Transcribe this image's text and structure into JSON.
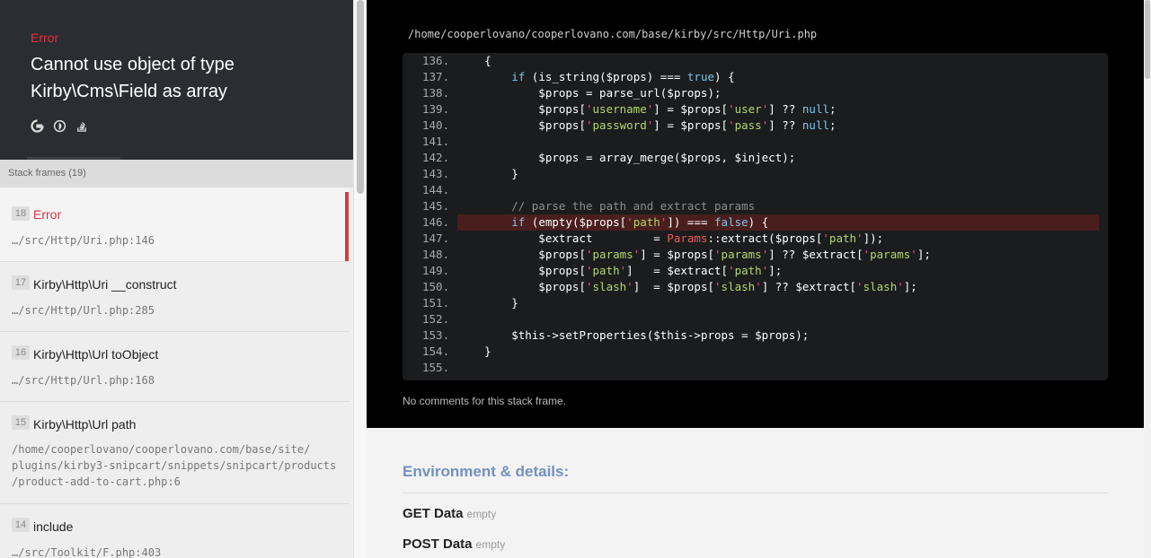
{
  "error": {
    "type": "Error",
    "message": "Cannot use object of type Kirby\\Cms\\Field as array",
    "icons": [
      "google-search-icon",
      "duckduckgo-search-icon",
      "stackoverflow-search-icon"
    ]
  },
  "frames_label": "Stack frames (19)",
  "frames": [
    {
      "num": "18",
      "name": "Error",
      "file": "…/src/Http/Uri.php:146"
    },
    {
      "num": "17",
      "name": "Kirby\\Http\\Uri __construct",
      "file": "…/src/Http/Url.php:285"
    },
    {
      "num": "16",
      "name": "Kirby\\Http\\Url toObject",
      "file": "…/src/Http/Url.php:168"
    },
    {
      "num": "15",
      "name": "Kirby\\Http\\Url path",
      "file": "/home/cooperlovano/cooperlovano.com/base/site/\nplugins/kirby3-snipcart/snippets/snipcart/products\n/product-add-to-cart.php:6"
    },
    {
      "num": "14",
      "name": "include",
      "file": "…/src/Toolkit/F.php:403"
    }
  ],
  "code": {
    "file_path": "/home/cooperlovano/cooperlovano.com/base/kirby/src/Http/Uri.php",
    "highlight_line": "146.",
    "lines": [
      {
        "n": "136.",
        "t": "    {"
      },
      {
        "n": "137.",
        "t": "        if (is_string($props) === true) {"
      },
      {
        "n": "138.",
        "t": "            $props = parse_url($props);"
      },
      {
        "n": "139.",
        "t": "            $props['username'] = $props['user'] ?? null;"
      },
      {
        "n": "140.",
        "t": "            $props['password'] = $props['pass'] ?? null;"
      },
      {
        "n": "141.",
        "t": ""
      },
      {
        "n": "142.",
        "t": "            $props = array_merge($props, $inject);"
      },
      {
        "n": "143.",
        "t": "        }"
      },
      {
        "n": "144.",
        "t": ""
      },
      {
        "n": "145.",
        "t": "        // parse the path and extract params"
      },
      {
        "n": "146.",
        "t": "        if (empty($props['path']) === false) {"
      },
      {
        "n": "147.",
        "t": "            $extract         = Params::extract($props['path']);"
      },
      {
        "n": "148.",
        "t": "            $props['params'] = $props['params'] ?? $extract['params'];"
      },
      {
        "n": "149.",
        "t": "            $props['path']   = $extract['path'];"
      },
      {
        "n": "150.",
        "t": "            $props['slash']  = $props['slash'] ?? $extract['slash'];"
      },
      {
        "n": "151.",
        "t": "        }"
      },
      {
        "n": "152.",
        "t": ""
      },
      {
        "n": "153.",
        "t": "        $this->setProperties($this->props = $props);"
      },
      {
        "n": "154.",
        "t": "    }"
      },
      {
        "n": "155.",
        "t": ""
      }
    ],
    "comments": "No comments for this stack frame."
  },
  "details": {
    "title": "Environment & details:",
    "rows": [
      {
        "label": "GET Data",
        "value": "empty"
      },
      {
        "label": "POST Data",
        "value": "empty"
      }
    ]
  }
}
